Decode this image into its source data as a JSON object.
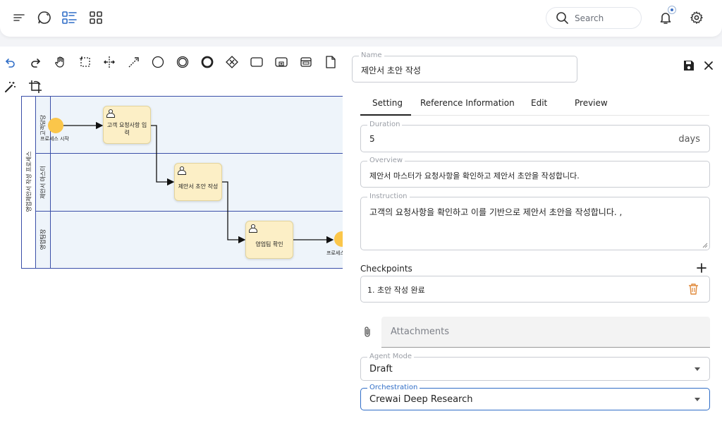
{
  "topbar": {
    "search_placeholder": "Search",
    "icons": [
      "menu-icon",
      "chat-bubble-icon",
      "list-view-icon",
      "grid-view-icon",
      "bell-icon",
      "gear-icon"
    ]
  },
  "toolbar": {
    "tools": [
      "undo-icon",
      "redo-icon",
      "hand-tool-icon",
      "lasso-tool-icon",
      "space-tool-icon",
      "connect-tool-icon",
      "start-event-icon",
      "intermediate-event-icon",
      "end-event-icon",
      "gateway-icon",
      "task-icon",
      "subprocess-icon",
      "data-store-icon",
      "data-object-icon",
      "magic-wand-icon",
      "crop-icon"
    ]
  },
  "diagram": {
    "pool_label": "영업제안서 작성 프로세스",
    "lanes": [
      "고객담당",
      "제안서 마스터",
      "영업팀장"
    ],
    "start_label": "프로세스 시작",
    "end_label": "프로세스 종",
    "tasks": [
      {
        "label": "고객 요청사항 입력"
      },
      {
        "label": "제안서 초안 작성"
      },
      {
        "label": "영업팀 확인"
      }
    ]
  },
  "panel": {
    "name_legend": "Name",
    "name_value": "제안서 초안 작성",
    "tabs": [
      "Setting",
      "Reference Information",
      "Edit",
      "Preview"
    ],
    "active_tab": "Setting",
    "duration_legend": "Duration",
    "duration_value": "5",
    "duration_unit": "days",
    "overview_legend": "Overview",
    "overview_value": "제안서 마스터가 요청사항을 확인하고 제안서 초안을 작성합니다.",
    "instruction_legend": "Instruction",
    "instruction_value": "고객의  요청사항을 확인하고 이를 기반으로 제안서 초안을 작성합니다. ,",
    "checkpoints_title": "Checkpoints",
    "checkpoints": [
      {
        "text": "1.  초안 작성 완료"
      }
    ],
    "attachments_label": "Attachments",
    "agent_mode_legend": "Agent Mode",
    "agent_mode_value": "Draft",
    "orchestration_legend": "Orchestration",
    "orchestration_value": "Crewai Deep Research"
  },
  "colors": {
    "lane_bg": "#eef4fa",
    "pool_border": "#3a4fa8",
    "task_fill": "#fcefc6",
    "event_fill": "#fbc64a",
    "focus_blue": "#2f6dc7",
    "delete_orange": "#e08a3c"
  }
}
